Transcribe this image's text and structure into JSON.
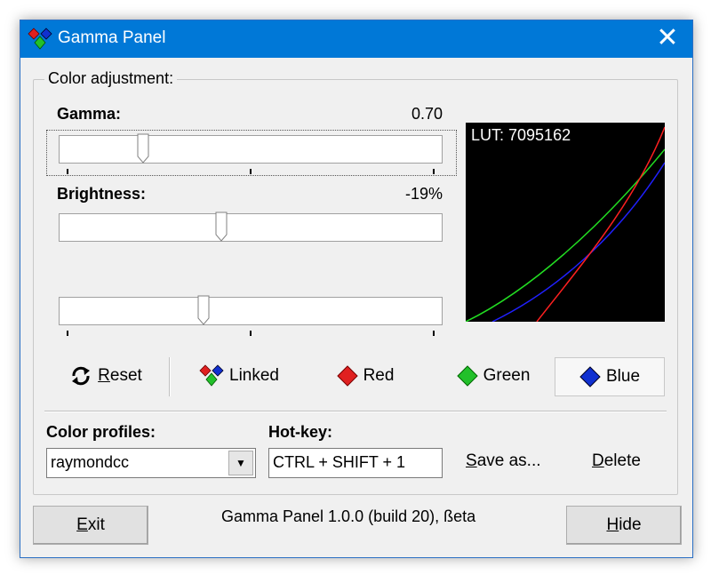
{
  "window": {
    "title": "Gamma Panel",
    "close_glyph": "✕",
    "icon": "gamma-panel-icon"
  },
  "group": {
    "label": "Color adjustment:"
  },
  "gamma": {
    "label": "Gamma:",
    "value": "0.70",
    "slider_fraction": 0.22
  },
  "brightness": {
    "label": "Brightness:",
    "value": "-19%",
    "slider_fraction": 0.42
  },
  "contrast": {
    "slider_fraction": 0.36
  },
  "lut": {
    "label": "LUT: 7095162"
  },
  "toolbar": {
    "reset": {
      "hotkey": "R",
      "rest": "eset",
      "icon": "reset-icon"
    },
    "linked": {
      "label": "Linked",
      "icon": "linked-diamonds-icon"
    },
    "red": {
      "label": "Red",
      "icon": "red-diamond-icon",
      "color": "#e02020"
    },
    "green": {
      "label": "Green",
      "icon": "green-diamond-icon",
      "color": "#22c02a"
    },
    "blue": {
      "label": "Blue",
      "icon": "blue-diamond-icon",
      "color": "#1030d0",
      "active": true
    }
  },
  "profiles": {
    "label": "Color profiles:",
    "selected": "raymondcc"
  },
  "hotkey": {
    "label": "Hot-key:",
    "value": "CTRL + SHIFT + 1"
  },
  "actions": {
    "save_as": {
      "hotkey": "S",
      "rest": "ave as..."
    },
    "delete": {
      "hotkey": "D",
      "rest": "elete"
    }
  },
  "footer": {
    "exit": {
      "hotkey": "E",
      "rest": "xit"
    },
    "hide": {
      "hotkey": "H",
      "rest": "ide"
    },
    "status": "Gamma Panel 1.0.0 (build 20), ßeta"
  }
}
